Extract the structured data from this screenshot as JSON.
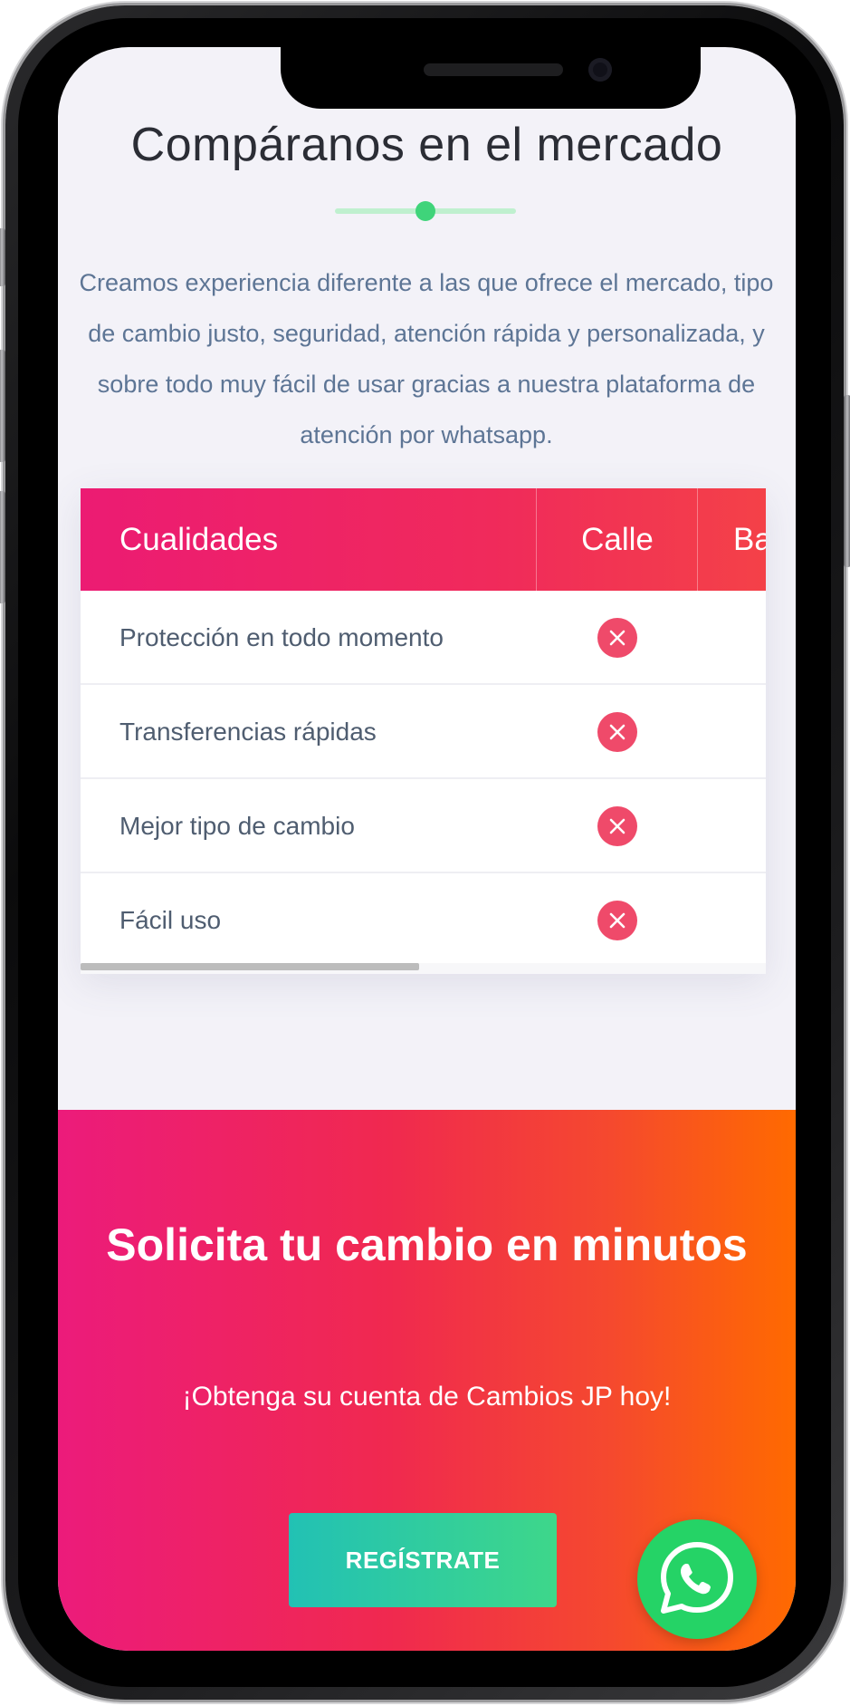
{
  "section": {
    "title": "Compáranos en el mercado",
    "intro": "Creamos experiencia diferente a las que ofrece el mercado, tipo de cambio justo, seguridad, atención rápida y personalizada, y sobre todo muy fácil de usar gracias a nuestra plataforma de atención por whatsapp."
  },
  "table": {
    "headers": [
      "Cualidades",
      "Calle",
      "Ba"
    ],
    "rows": [
      {
        "label": "Protección en todo momento",
        "calle_icon": "x-circle-icon"
      },
      {
        "label": "Transferencias rápidas",
        "calle_icon": "x-circle-icon"
      },
      {
        "label": "Mejor tipo de cambio",
        "calle_icon": "x-circle-icon"
      },
      {
        "label": "Fácil uso",
        "calle_icon": "x-circle-icon"
      }
    ],
    "horizontal_scroll_position": 0,
    "visible_fraction": 0.49
  },
  "cta": {
    "title": "Solicita tu cambio en minutos",
    "subtitle": "¡Obtenga su cuenta de Cambios JP hoy!",
    "button_label": "REGÍSTRATE"
  },
  "floating": {
    "whatsapp_icon": "whatsapp-icon"
  },
  "colors": {
    "table_header_start": "#ec1b73",
    "table_header_end": "#f44148",
    "x_icon": "#ef4a6a",
    "cta_start": "#ec1b7b",
    "cta_end": "#ff6a00",
    "button_start": "#22c1b4",
    "button_end": "#3ed78a",
    "whatsapp": "#25d366",
    "divider_dot": "#3fd47a"
  }
}
